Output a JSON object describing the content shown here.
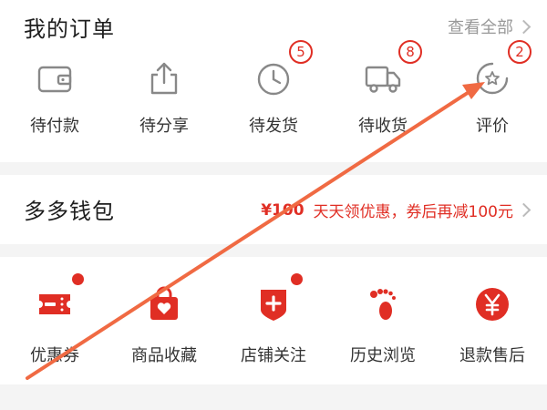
{
  "orders": {
    "title": "我的订单",
    "view_all": "查看全部",
    "items": [
      {
        "label": "待付款",
        "badge": null
      },
      {
        "label": "待分享",
        "badge": null
      },
      {
        "label": "待发货",
        "badge": "5"
      },
      {
        "label": "待收货",
        "badge": "8"
      },
      {
        "label": "评价",
        "badge": "2"
      }
    ]
  },
  "wallet": {
    "title": "多多钱包",
    "amount": "¥100",
    "promo": "天天领优惠，券后再减100元"
  },
  "tools": {
    "items": [
      {
        "label": "优惠券",
        "icon": "coupon-icon"
      },
      {
        "label": "商品收藏",
        "icon": "bag-heart-icon"
      },
      {
        "label": "店铺关注",
        "icon": "store-follow-icon"
      },
      {
        "label": "历史浏览",
        "icon": "footprint-icon"
      },
      {
        "label": "退款售后",
        "icon": "refund-yen-icon"
      }
    ]
  },
  "colors": {
    "accent": "#e02e24",
    "icon_gray": "#888888",
    "annotation_arrow": "#f06a43"
  }
}
